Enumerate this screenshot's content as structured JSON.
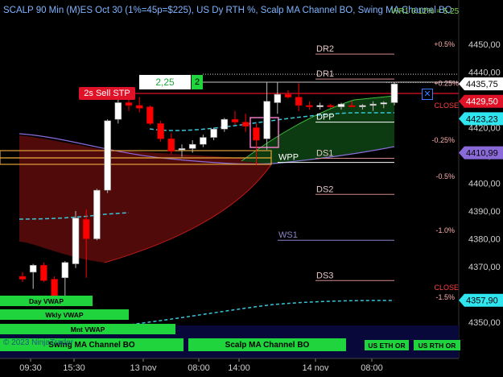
{
  "header": {
    "title": "SCALP 90 Min (M)ES Oct 30 (1%=45p=$225), US Dy RTH %, Scalp MA Channel BO, Swing MA Channel BO",
    "right_overlay": "WR1  0.12% = 5.25"
  },
  "order": {
    "label": "2s  Sell STP",
    "price": "2,25",
    "qty": "2",
    "cancel_glyph": "✕"
  },
  "buttons": {
    "day_vwap": "Day VWAP",
    "wkly_vwap": "Wkly VWAP",
    "mnt_vwap": "Mnt VWAP",
    "swing": "Swing MA Channel BO",
    "scalp": "Scalp MA Channel BO",
    "eth": "US ETH OR",
    "rth": "US RTH OR"
  },
  "watermark": "© 2023 NinjaTrader",
  "colors": {
    "bullish": "#ffffff",
    "bearish": "#ff0000",
    "fill_red": "#5a0b0b",
    "fill_green": "#0d3d12",
    "dashed_vwap": "#38c6d8",
    "purple_ma": "#8a6ad8",
    "level_pink": "#d28a8a",
    "level_purple": "#8a86c8",
    "accent_green": "#1fd43c",
    "accent_cyan": "#2fe6f0"
  },
  "chart_data": {
    "type": "candlestick",
    "title": "SCALP 90 Min (M)ES Oct 30",
    "ylim": [
      4344,
      4458
    ],
    "y_ticks": [
      "4450,00",
      "4440,00",
      "4435,75",
      "4430,00",
      "4420,00",
      "4410,00",
      "4400,00",
      "4390,00",
      "4380,00",
      "4370,00",
      "4350,00"
    ],
    "x_ticks": [
      "09:30",
      "15:30",
      "13 nov",
      "08:00",
      "14:00",
      "14 nov",
      "08:00"
    ],
    "candles": [
      {
        "o": 4366.5,
        "h": 4368.0,
        "l": 4364.5,
        "c": 4365.5
      },
      {
        "o": 4368.0,
        "h": 4371.0,
        "l": 4362.0,
        "c": 4370.5
      },
      {
        "o": 4370.5,
        "h": 4371.5,
        "l": 4364.5,
        "c": 4365.0
      },
      {
        "o": 4365.5,
        "h": 4366.5,
        "l": 4358.5,
        "c": 4359.5
      },
      {
        "o": 4366.0,
        "h": 4372.0,
        "l": 4358.0,
        "c": 4371.5
      },
      {
        "o": 4371.0,
        "h": 4390.0,
        "l": 4369.5,
        "c": 4387.5
      },
      {
        "o": 4387.0,
        "h": 4390.5,
        "l": 4366.0,
        "c": 4380.0
      },
      {
        "o": 4380.0,
        "h": 4398.0,
        "l": 4379.5,
        "c": 4397.5
      },
      {
        "o": 4397.5,
        "h": 4423.0,
        "l": 4396.5,
        "c": 4422.5
      },
      {
        "o": 4423.0,
        "h": 4430.5,
        "l": 4421.5,
        "c": 4429.0
      },
      {
        "o": 4429.0,
        "h": 4431.0,
        "l": 4426.0,
        "c": 4428.0
      },
      {
        "o": 4428.0,
        "h": 4431.0,
        "l": 4425.5,
        "c": 4427.0
      },
      {
        "o": 4427.5,
        "h": 4428.0,
        "l": 4421.0,
        "c": 4421.5
      },
      {
        "o": 4421.5,
        "h": 4422.5,
        "l": 4415.0,
        "c": 4416.0
      },
      {
        "o": 4416.0,
        "h": 4418.0,
        "l": 4410.5,
        "c": 4411.5
      },
      {
        "o": 4412.0,
        "h": 4414.0,
        "l": 4409.5,
        "c": 4412.5
      },
      {
        "o": 4412.5,
        "h": 4415.5,
        "l": 4411.0,
        "c": 4414.0
      },
      {
        "o": 4414.0,
        "h": 4417.5,
        "l": 4413.0,
        "c": 4416.5
      },
      {
        "o": 4416.5,
        "h": 4420.0,
        "l": 4415.5,
        "c": 4419.5
      },
      {
        "o": 4419.5,
        "h": 4423.5,
        "l": 4418.5,
        "c": 4423.0
      },
      {
        "o": 4423.0,
        "h": 4426.0,
        "l": 4421.0,
        "c": 4422.0
      },
      {
        "o": 4422.0,
        "h": 4425.0,
        "l": 4418.5,
        "c": 4420.5
      },
      {
        "o": 4420.0,
        "h": 4421.5,
        "l": 4406.5,
        "c": 4415.5
      },
      {
        "o": 4416.0,
        "h": 4436.5,
        "l": 4412.0,
        "c": 4429.5
      },
      {
        "o": 4429.0,
        "h": 4436.5,
        "l": 4425.0,
        "c": 4432.0
      },
      {
        "o": 4432.0,
        "h": 4433.5,
        "l": 4430.5,
        "c": 4431.0
      },
      {
        "o": 4431.0,
        "h": 4436.0,
        "l": 4426.0,
        "c": 4428.0
      },
      {
        "o": 4428.0,
        "h": 4429.5,
        "l": 4426.5,
        "c": 4427.5
      },
      {
        "o": 4427.5,
        "h": 4429.0,
        "l": 4426.5,
        "c": 4428.0
      },
      {
        "o": 4428.0,
        "h": 4428.5,
        "l": 4427.0,
        "c": 4427.5
      },
      {
        "o": 4427.5,
        "h": 4429.0,
        "l": 4426.5,
        "c": 4428.5
      },
      {
        "o": 4428.0,
        "h": 4429.5,
        "l": 4427.5,
        "c": 4427.5
      },
      {
        "o": 4427.5,
        "h": 4428.5,
        "l": 4426.5,
        "c": 4428.0
      },
      {
        "o": 4428.0,
        "h": 4429.5,
        "l": 4426.0,
        "c": 4428.5
      },
      {
        "o": 4428.5,
        "h": 4429.5,
        "l": 4427.0,
        "c": 4429.0
      },
      {
        "o": 4429.0,
        "h": 4436.5,
        "l": 4428.0,
        "c": 4435.75
      }
    ],
    "levels": [
      {
        "name": "DR2",
        "value": 4446.5,
        "color": "#d28a8a"
      },
      {
        "name": "DR1",
        "value": 4437.5,
        "color": "#d28a8a"
      },
      {
        "name": "DPP",
        "value": 4422.0,
        "color": "#ffffff"
      },
      {
        "name": "DS1",
        "value": 4409.0,
        "color": "#d28a8a"
      },
      {
        "name": "WPP",
        "value": 4407.5,
        "color": "#ffffff"
      },
      {
        "name": "DS2",
        "value": 4396.0,
        "color": "#d28a8a"
      },
      {
        "name": "WS1",
        "value": 4379.5,
        "color": "#8a86c8"
      },
      {
        "name": "DS3",
        "value": 4365.0,
        "color": "#d28a8a"
      }
    ],
    "percent_labels": [
      {
        "text": "+0.5%",
        "value": 4450.0
      },
      {
        "text": "+0.25%",
        "value": 4436.0
      },
      {
        "text": "CLOSE",
        "value": 4428.0
      },
      {
        "text": "-0.25%",
        "value": 4415.5
      },
      {
        "text": "-0.5%",
        "value": 4402.5
      },
      {
        "text": "-1.0%",
        "value": 4383.0
      },
      {
        "text": "CLOSE",
        "value": 4362.5
      },
      {
        "text": "-1.5%",
        "value": 4359.0
      }
    ],
    "price_tags": [
      {
        "text": "4435,75",
        "value": 4435.75,
        "bg": "#ffffff",
        "fg": "#000000"
      },
      {
        "text": "4429,50",
        "value": 4429.5,
        "bg": "#e01227",
        "fg": "#ffffff"
      },
      {
        "text": "4423,23",
        "value": 4423.23,
        "bg": "#2fe6f0",
        "fg": "#000000"
      },
      {
        "text": "4410,99",
        "value": 4410.99,
        "bg": "#8a6ad8",
        "fg": "#000000"
      },
      {
        "text": "4357,90",
        "value": 4357.9,
        "bg": "#2fe6f0",
        "fg": "#000000"
      }
    ]
  }
}
